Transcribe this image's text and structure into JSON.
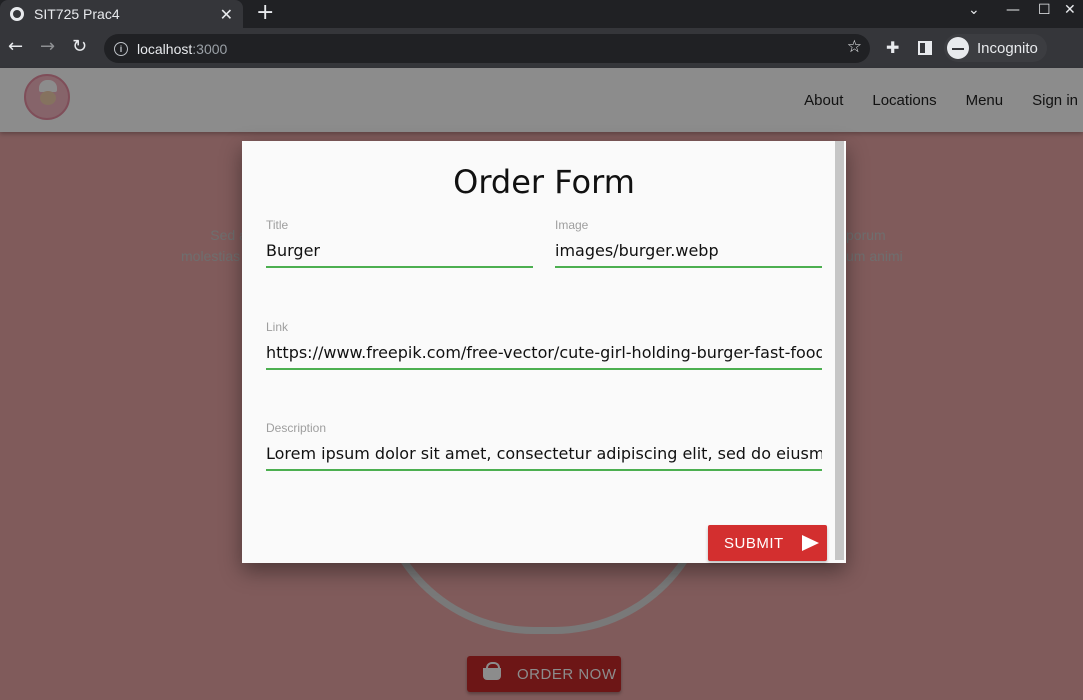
{
  "browser": {
    "tab_title": "SIT725 Prac4",
    "tab_close": "✕",
    "new_tab": "+",
    "url_host": "localhost",
    "url_port": ":3000",
    "profile_label": "Incognito"
  },
  "site": {
    "nav": [
      "About",
      "Locations",
      "Menu",
      "Sign in"
    ],
    "hero_left": [
      "Sed al",
      "molestias"
    ],
    "hero_right": [
      "porum",
      "um animi"
    ],
    "order_now_label": "ORDER NOW"
  },
  "modal": {
    "title": "Order Form",
    "fields": {
      "title": {
        "label": "Title",
        "value": "Burger"
      },
      "image": {
        "label": "Image",
        "value": "images/burger.webp"
      },
      "link": {
        "label": "Link",
        "value": "https://www.freepik.com/free-vector/cute-girl-holding-burger-fast-food-logo"
      },
      "description": {
        "label": "Description",
        "value": "Lorem ipsum dolor sit amet, consectetur adipiscing elit, sed do eiusmod temp"
      }
    },
    "submit_label": "SUBMIT"
  },
  "colors": {
    "accent": "#d32f2f",
    "underline": "#4caf50",
    "page_bg": "#e9a6a6"
  }
}
